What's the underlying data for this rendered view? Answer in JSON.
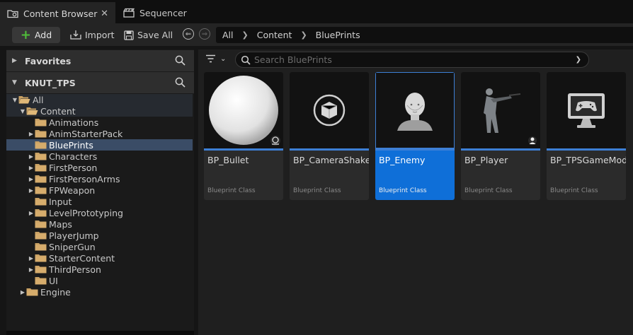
{
  "tabs": [
    {
      "label": "Content Browser",
      "icon": "content-browser-icon",
      "active": true,
      "close": "✕"
    },
    {
      "label": "Sequencer",
      "icon": "clapperboard-icon",
      "active": false
    }
  ],
  "toolbar": {
    "add_label": "Add",
    "import_label": "Import",
    "save_all_label": "Save All"
  },
  "path": [
    "All",
    "Content",
    "BluePrints"
  ],
  "left": {
    "favorites_label": "Favorites",
    "project_label": "KNUT_TPS"
  },
  "tree": [
    {
      "label": "All",
      "depth": 0,
      "expanded": true,
      "open_folder": true
    },
    {
      "label": "Content",
      "depth": 1,
      "expanded": true,
      "open_folder": true
    },
    {
      "label": "Animations",
      "depth": 2,
      "expanded": null
    },
    {
      "label": "AnimStarterPack",
      "depth": 2,
      "expanded": false
    },
    {
      "label": "BluePrints",
      "depth": 2,
      "expanded": null,
      "selected": true
    },
    {
      "label": "Characters",
      "depth": 2,
      "expanded": false
    },
    {
      "label": "FirstPerson",
      "depth": 2,
      "expanded": false
    },
    {
      "label": "FirstPersonArms",
      "depth": 2,
      "expanded": false
    },
    {
      "label": "FPWeapon",
      "depth": 2,
      "expanded": false
    },
    {
      "label": "Input",
      "depth": 2,
      "expanded": null
    },
    {
      "label": "LevelPrototyping",
      "depth": 2,
      "expanded": false
    },
    {
      "label": "Maps",
      "depth": 2,
      "expanded": null
    },
    {
      "label": "PlayerJump",
      "depth": 2,
      "expanded": null
    },
    {
      "label": "SniperGun",
      "depth": 2,
      "expanded": null
    },
    {
      "label": "StarterContent",
      "depth": 2,
      "expanded": false
    },
    {
      "label": "ThirdPerson",
      "depth": 2,
      "expanded": false
    },
    {
      "label": "UI",
      "depth": 2,
      "expanded": null
    },
    {
      "label": "Engine",
      "depth": 1,
      "expanded": false
    }
  ],
  "search": {
    "placeholder": "Search BluePrints"
  },
  "assets": [
    {
      "name": "BP_Bullet",
      "class": "Blueprint Class",
      "thumb": "sphere-icon",
      "selected": false
    },
    {
      "name": "BP_CameraShake",
      "class": "Blueprint Class",
      "thumb": "cube-icon",
      "selected": false
    },
    {
      "name": "BP_Enemy",
      "class": "Blueprint Class",
      "thumb": "mannequin-head-icon",
      "selected": true
    },
    {
      "name": "BP_Player",
      "class": "Blueprint Class",
      "thumb": "soldier-icon",
      "selected": false
    },
    {
      "name": "BP_TPSGameMode",
      "class": "Blueprint Class",
      "thumb": "monitor-gamepad-icon",
      "selected": false
    }
  ],
  "colors": {
    "accent": "#0f6fd8",
    "selection": "#3a4c66",
    "folder": "#c9a163",
    "add_plus": "#4fbe3a"
  }
}
